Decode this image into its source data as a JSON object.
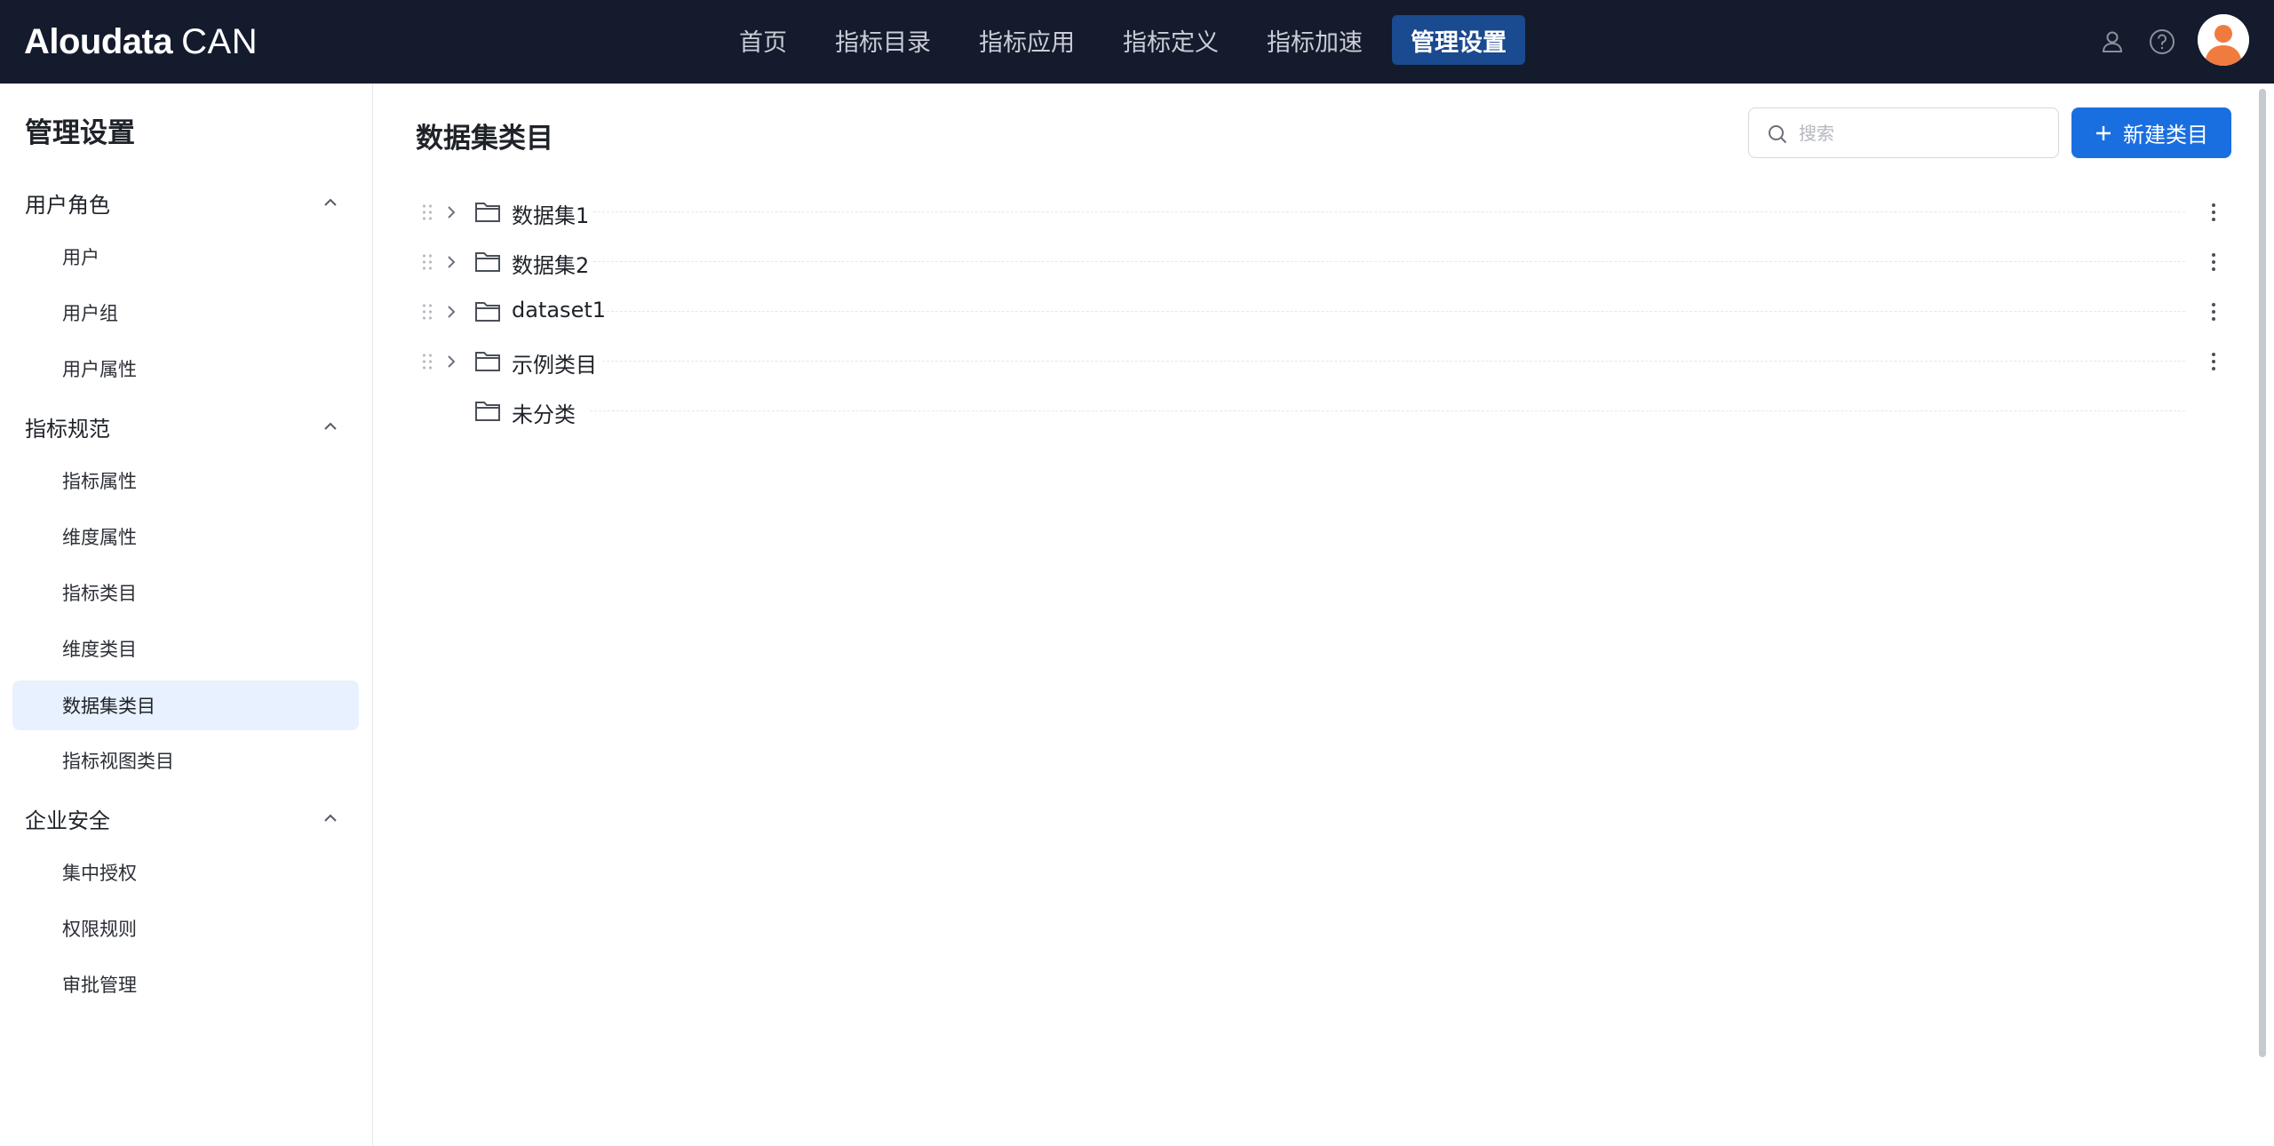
{
  "app": {
    "logo_main": "Aloudata",
    "logo_sub": "CAN"
  },
  "nav": {
    "items": [
      {
        "label": "首页"
      },
      {
        "label": "指标目录"
      },
      {
        "label": "指标应用"
      },
      {
        "label": "指标定义"
      },
      {
        "label": "指标加速"
      },
      {
        "label": "管理设置",
        "active": true
      }
    ]
  },
  "header_icons": {
    "user": "user-icon",
    "help": "help-circle-icon",
    "avatar": "avatar"
  },
  "sidebar": {
    "title": "管理设置",
    "groups": [
      {
        "label": "用户角色",
        "items": [
          {
            "label": "用户"
          },
          {
            "label": "用户组"
          },
          {
            "label": "用户属性"
          }
        ]
      },
      {
        "label": "指标规范",
        "items": [
          {
            "label": "指标属性"
          },
          {
            "label": "维度属性"
          },
          {
            "label": "指标类目"
          },
          {
            "label": "维度类目"
          },
          {
            "label": "数据集类目",
            "active": true
          },
          {
            "label": "指标视图类目"
          }
        ]
      },
      {
        "label": "企业安全",
        "items": [
          {
            "label": "集中授权"
          },
          {
            "label": "权限规则"
          },
          {
            "label": "审批管理"
          }
        ]
      }
    ]
  },
  "main": {
    "title": "数据集类目",
    "search": {
      "placeholder": "搜索",
      "value": ""
    },
    "new_button": "新建类目",
    "tree": [
      {
        "label": "数据集1",
        "expandable": true
      },
      {
        "label": "数据集2",
        "expandable": true
      },
      {
        "label": "dataset1",
        "expandable": true
      },
      {
        "label": "示例类目",
        "expandable": true
      },
      {
        "label": "未分类",
        "expandable": false
      }
    ]
  },
  "colors": {
    "header_bg": "#141b2d",
    "nav_active_bg": "#1a4a8f",
    "primary": "#1a6fe0",
    "sidebar_active_bg": "#e8f1ff",
    "avatar_orange": "#f07b3f"
  }
}
